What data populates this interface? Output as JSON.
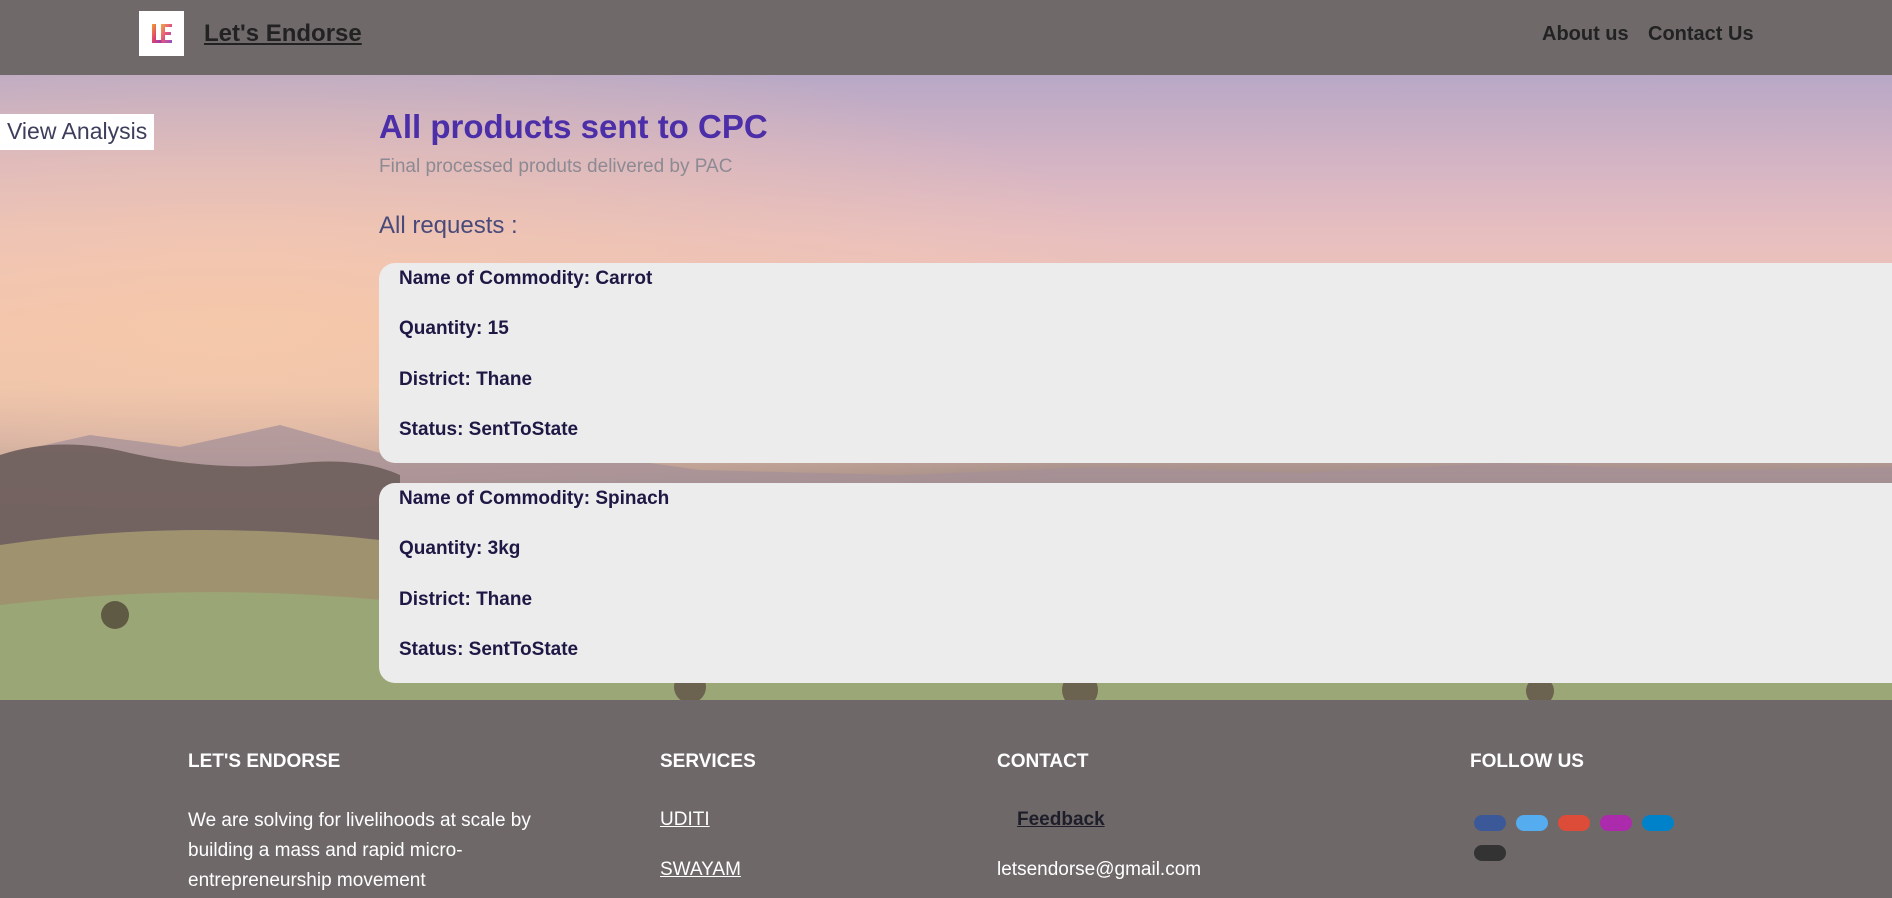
{
  "navbar": {
    "logo_text": "LE",
    "brand": "Let's Endorse",
    "links": [
      "About us",
      "Contact Us"
    ]
  },
  "sidebar": {
    "view_analysis": "View Analysis"
  },
  "main": {
    "title": "All products sent to CPC",
    "subtitle": "Final processed produts delivered by PAC",
    "requests_heading": "All requests :",
    "requests": [
      {
        "commodity": "Name of Commodity: Carrot",
        "quantity": "Quantity: 15",
        "district": "District: Thane",
        "status": "Status: SentToState"
      },
      {
        "commodity": "Name of Commodity: Spinach",
        "quantity": "Quantity: 3kg",
        "district": "District: Thane",
        "status": "Status: SentToState"
      }
    ]
  },
  "footer": {
    "about_heading": "LET'S ENDORSE",
    "about_text": "We are solving for livelihoods at scale by building a mass and rapid micro-entrepreneurship movement",
    "services_heading": "SERVICES",
    "services": [
      "UDITI",
      "SWAYAM"
    ],
    "contact_heading": "CONTACT",
    "feedback": "Feedback",
    "email": "letsendorse@gmail.com",
    "follow_heading": "FOLLOW US",
    "social": [
      {
        "icon": "facebook-icon",
        "color": "#3b5998"
      },
      {
        "icon": "twitter-icon",
        "color": "#55acee"
      },
      {
        "icon": "google-icon",
        "color": "#dd4b39"
      },
      {
        "icon": "instagram-icon",
        "color": "#ac2bac"
      },
      {
        "icon": "linkedin-icon",
        "color": "#0082ca"
      },
      {
        "icon": "github-icon",
        "color": "#333333"
      }
    ]
  },
  "colors": {
    "title": "#4b2ea8",
    "card_bg": "#ececec",
    "card_text": "#1f1744",
    "nav_bg": "#6f6969"
  }
}
